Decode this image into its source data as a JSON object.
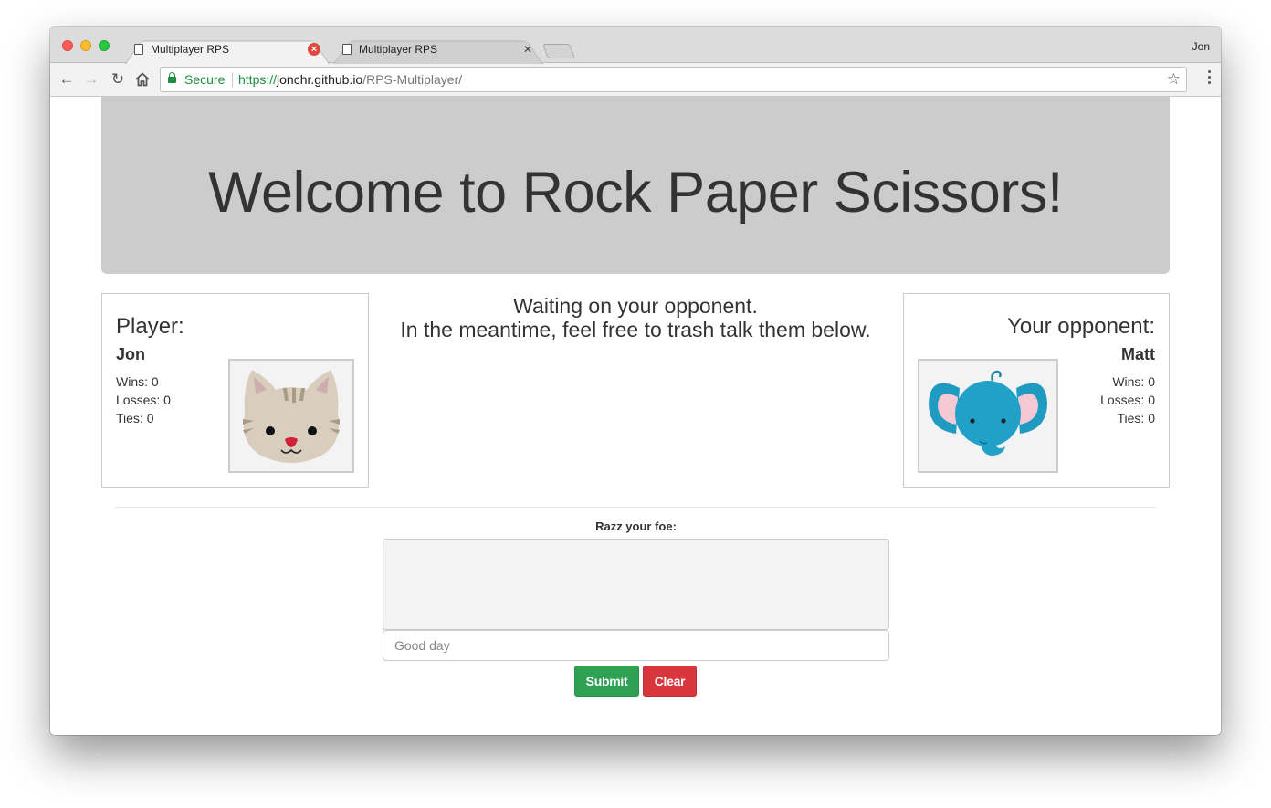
{
  "browser": {
    "tabs": [
      {
        "title": "Multiplayer RPS"
      },
      {
        "title": "Multiplayer RPS"
      }
    ],
    "profile_name": "Jon",
    "security_label": "Secure",
    "url": {
      "scheme": "https://",
      "host": "jonchr.github.io",
      "path": "/RPS-Multiplayer/"
    }
  },
  "page": {
    "heading": "Welcome to Rock Paper Scissors!",
    "player": {
      "title": "Player:",
      "name": "Jon",
      "wins": "Wins: 0",
      "losses": "Losses: 0",
      "ties": "Ties: 0",
      "avatar": "cat-icon"
    },
    "status": {
      "line1": "Waiting on your opponent.",
      "line2": "In the meantime, feel free to trash talk them below."
    },
    "opponent": {
      "title": "Your opponent:",
      "name": "Matt",
      "wins": "Wins: 0",
      "losses": "Losses: 0",
      "ties": "Ties: 0",
      "avatar": "elephant-icon"
    },
    "chat": {
      "label": "Razz your foe:",
      "placeholder": "Good day",
      "submit_label": "Submit",
      "clear_label": "Clear"
    }
  },
  "colors": {
    "jumbotron_bg": "#cccccc",
    "submit_green": "#2fa153",
    "clear_red": "#d9353c",
    "secure_green": "#1e8e3e"
  }
}
